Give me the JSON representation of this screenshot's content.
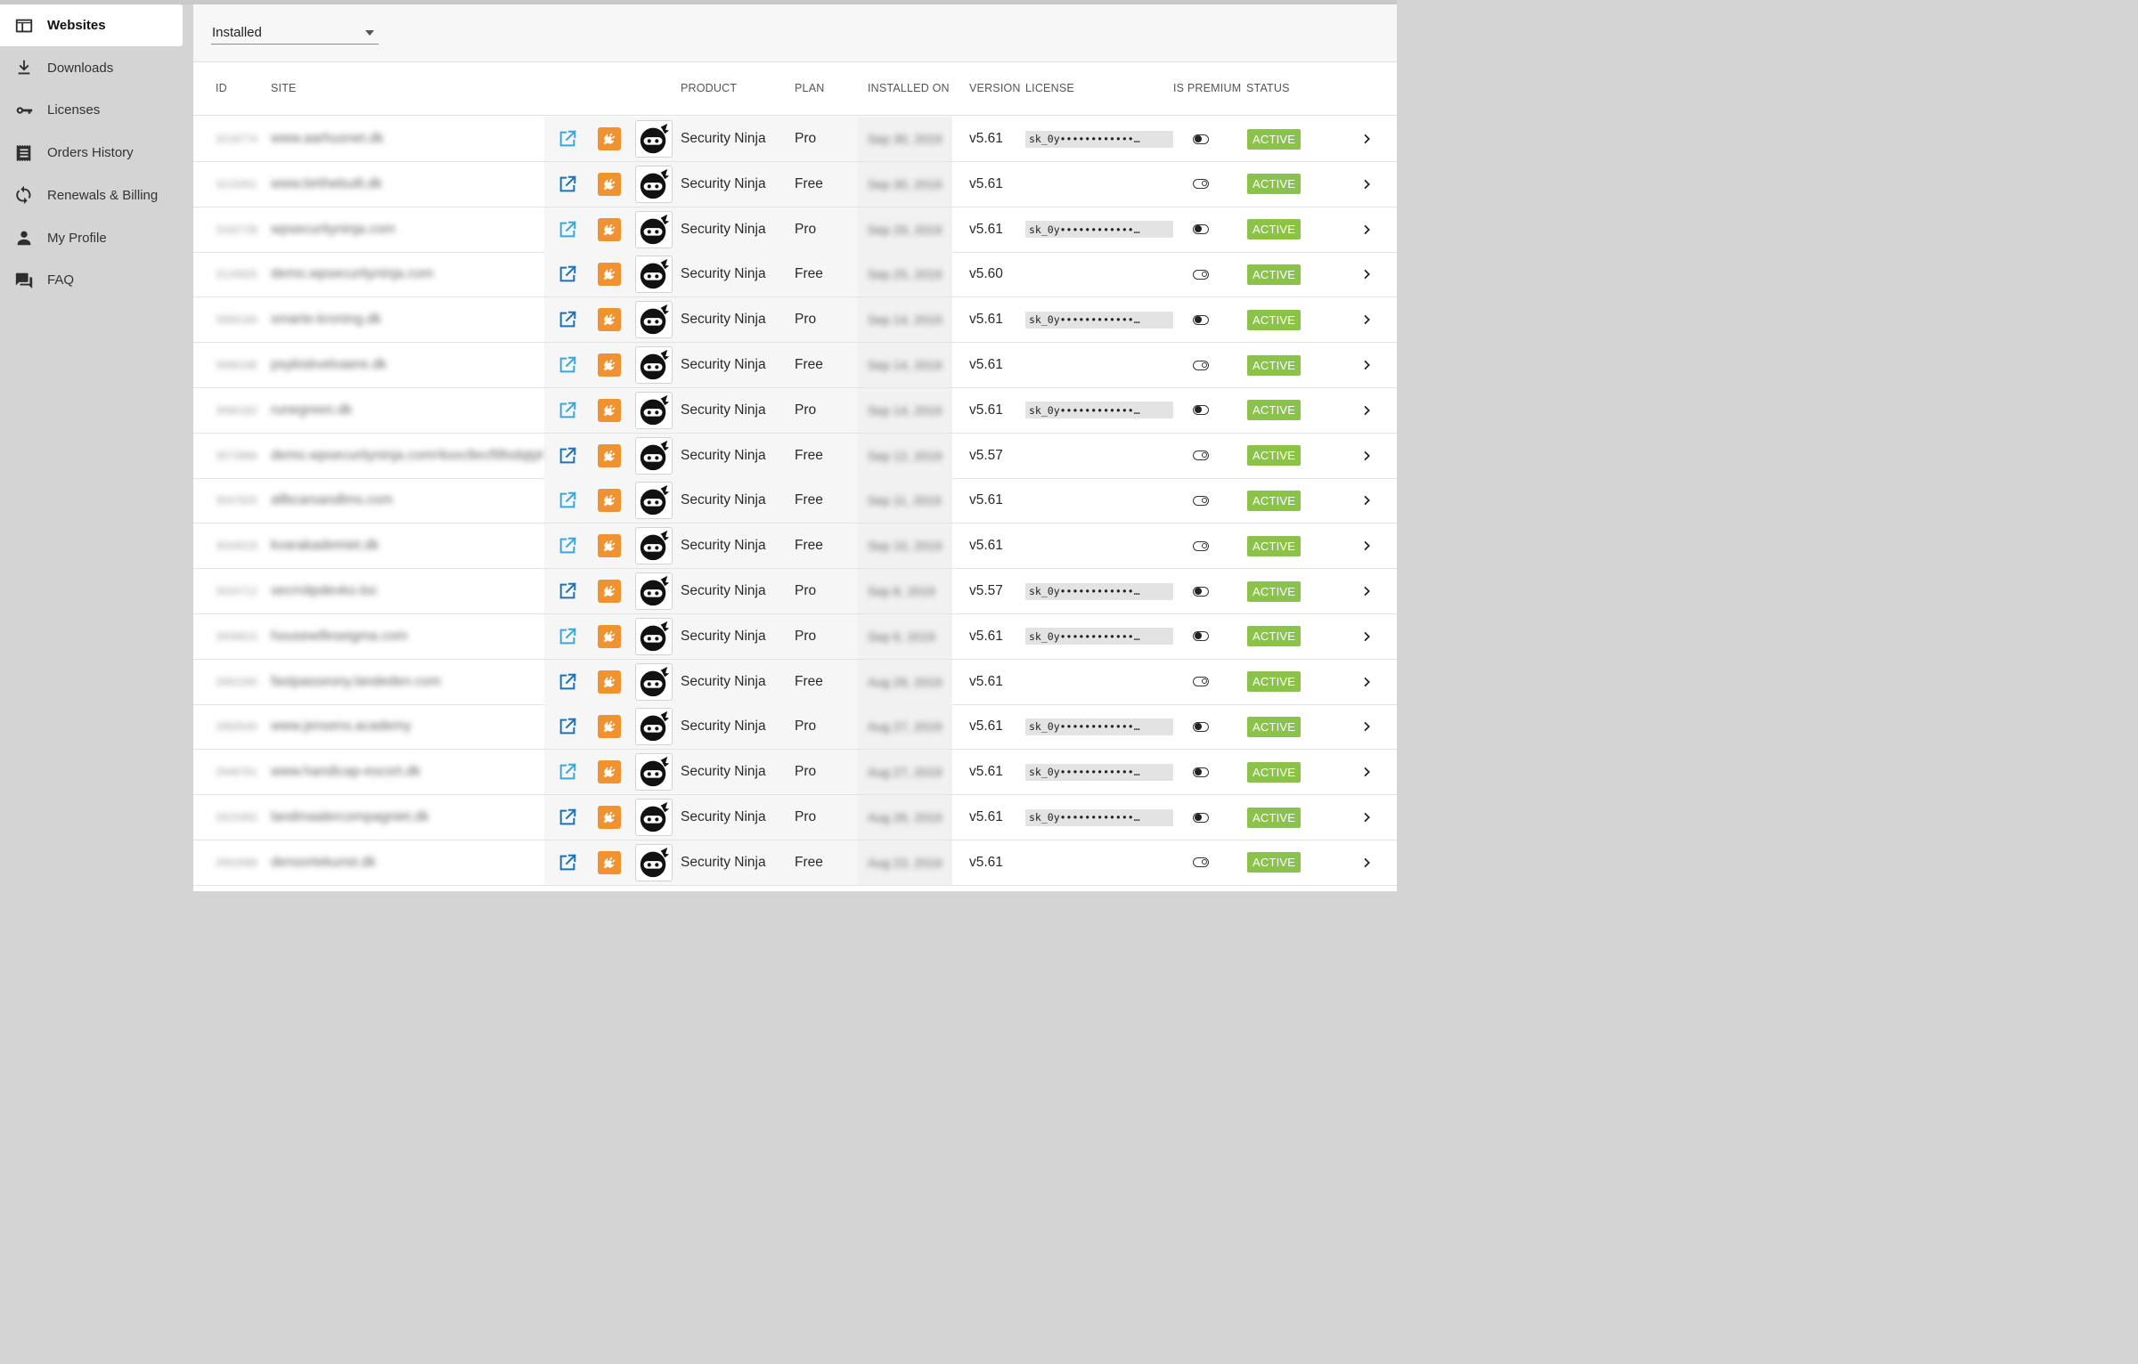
{
  "sidebar": {
    "items": [
      {
        "label": "Websites",
        "icon": "browser-window-icon",
        "active": true
      },
      {
        "label": "Downloads",
        "icon": "download-icon",
        "active": false
      },
      {
        "label": "Licenses",
        "icon": "key-icon",
        "active": false
      },
      {
        "label": "Orders History",
        "icon": "receipt-icon",
        "active": false
      },
      {
        "label": "Renewals & Billing",
        "icon": "refresh-icon",
        "active": false
      },
      {
        "label": "My Profile",
        "icon": "person-icon",
        "active": false
      },
      {
        "label": "FAQ",
        "icon": "chat-icon",
        "active": false
      }
    ]
  },
  "filter": {
    "selected": "Installed"
  },
  "table": {
    "headers": {
      "id": "ID",
      "site": "SITE",
      "product": "PRODUCT",
      "plan": "PLAN",
      "installed_on": "INSTALLED ON",
      "version": "VERSION",
      "license": "LICENSE",
      "is_premium": "IS PREMIUM",
      "status": "STATUS"
    },
    "rows": [
      {
        "id": "3218774",
        "site": "www.aarhusnet.dk",
        "product": "Security Ninja",
        "plan": "Pro",
        "installed_on": "Sep 30, 2019",
        "version": "v5.61",
        "license": "sk_0y••••••••••••…",
        "premium": true,
        "status": "ACTIVE"
      },
      {
        "id": "3215001",
        "site": "www.birthebuilt.dk",
        "product": "Security Ninja",
        "plan": "Free",
        "installed_on": "Sep 30, 2019",
        "version": "v5.61",
        "license": "",
        "premium": false,
        "status": "ACTIVE"
      },
      {
        "id": "3162728",
        "site": "wpsecurityninja.com",
        "product": "Security Ninja",
        "plan": "Pro",
        "installed_on": "Sep 29, 2019",
        "version": "v5.61",
        "license": "sk_0y••••••••••••…",
        "premium": true,
        "status": "ACTIVE"
      },
      {
        "id": "3124925",
        "site": "demo.wpsecurityninja.com",
        "product": "Security Ninja",
        "plan": "Free",
        "installed_on": "Sep 25, 2019",
        "version": "v5.60",
        "license": "",
        "premium": false,
        "status": "ACTIVE"
      },
      {
        "id": "3066184",
        "site": "smarte-kroning.dk",
        "product": "Security Ninja",
        "plan": "Pro",
        "installed_on": "Sep 14, 2019",
        "version": "v5.61",
        "license": "sk_0y••••••••••••…",
        "premium": true,
        "status": "ACTIVE"
      },
      {
        "id": "3066186",
        "site": "psykiskvelvaere.dk",
        "product": "Security Ninja",
        "plan": "Free",
        "installed_on": "Sep 14, 2019",
        "version": "v5.61",
        "license": "",
        "premium": false,
        "status": "ACTIVE"
      },
      {
        "id": "3066182",
        "site": "runegreen.dk",
        "product": "Security Ninja",
        "plan": "Pro",
        "installed_on": "Sep 14, 2019",
        "version": "v5.61",
        "license": "sk_0y••••••••••••…",
        "premium": true,
        "status": "ACTIVE"
      },
      {
        "id": "3073966",
        "site": "demo.wpsecurityninja.com/4ooc8ecf9fodqtpkt",
        "product": "Security Ninja",
        "plan": "Free",
        "installed_on": "Sep 12, 2019",
        "version": "v5.57",
        "license": "",
        "premium": false,
        "status": "ACTIVE"
      },
      {
        "id": "3047820",
        "site": "allbcarsandlms.com",
        "product": "Security Ninja",
        "plan": "Free",
        "installed_on": "Sep 11, 2019",
        "version": "v5.61",
        "license": "",
        "premium": false,
        "status": "ACTIVE"
      },
      {
        "id": "3044019",
        "site": "kvarakademiet.dk",
        "product": "Security Ninja",
        "plan": "Free",
        "installed_on": "Sep 10, 2019",
        "version": "v5.61",
        "license": "",
        "premium": false,
        "status": "ACTIVE"
      },
      {
        "id": "3024712",
        "site": "secrnitpdevko.loc",
        "product": "Security Ninja",
        "plan": "Pro",
        "installed_on": "Sep 8, 2019",
        "version": "v5.57",
        "license": "sk_0y••••••••••••…",
        "premium": true,
        "status": "ACTIVE"
      },
      {
        "id": "3009915",
        "site": "housewifeseigma.com",
        "product": "Security Ninja",
        "plan": "Pro",
        "installed_on": "Sep 6, 2019",
        "version": "v5.61",
        "license": "sk_0y••••••••••••…",
        "premium": true,
        "status": "ACTIVE"
      },
      {
        "id": "2992290",
        "site": "fastpassesny.landeden.com",
        "product": "Security Ninja",
        "plan": "Free",
        "installed_on": "Aug 28, 2019",
        "version": "v5.61",
        "license": "",
        "premium": false,
        "status": "ACTIVE"
      },
      {
        "id": "2950540",
        "site": "www.jensens.academy",
        "product": "Security Ninja",
        "plan": "Pro",
        "installed_on": "Aug 27, 2019",
        "version": "v5.61",
        "license": "sk_0y••••••••••••…",
        "premium": true,
        "status": "ACTIVE"
      },
      {
        "id": "2946761",
        "site": "www.handicap-escort.dk",
        "product": "Security Ninja",
        "plan": "Pro",
        "installed_on": "Aug 27, 2019",
        "version": "v5.61",
        "license": "sk_0y••••••••••••…",
        "premium": true,
        "status": "ACTIVE"
      },
      {
        "id": "2915455",
        "site": "landmaalercompagniet.dk",
        "product": "Security Ninja",
        "plan": "Pro",
        "installed_on": "Aug 26, 2019",
        "version": "v5.61",
        "license": "sk_0y••••••••••••…",
        "premium": true,
        "status": "ACTIVE"
      },
      {
        "id": "2902688",
        "site": "densortekunst.dk",
        "product": "Security Ninja",
        "plan": "Free",
        "installed_on": "Aug 23, 2019",
        "version": "v5.61",
        "license": "",
        "premium": false,
        "status": "ACTIVE"
      }
    ]
  },
  "colors": {
    "accent_blue": "#1a73b8",
    "accent_blue_light": "#3ba6de",
    "plugin_orange": "#f0922f",
    "status_green": "#8bc34a",
    "sidebar_bg": "#d4d4d4"
  }
}
